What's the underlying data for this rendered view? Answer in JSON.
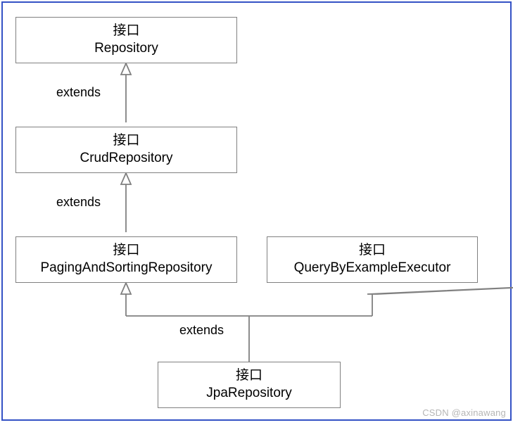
{
  "diagram": {
    "stereotype_label": "接口",
    "nodes": {
      "repository": {
        "name": "Repository"
      },
      "crud": {
        "name": "CrudRepository"
      },
      "paging": {
        "name": "PagingAndSortingRepository"
      },
      "qbe": {
        "name": "QueryByExampleExecutor"
      },
      "jpa": {
        "name": "JpaRepository"
      }
    },
    "edges": {
      "crud_to_repo": {
        "label": "extends"
      },
      "paging_to_crud": {
        "label": "extends"
      },
      "jpa_to_parents": {
        "label": "extends"
      }
    }
  },
  "watermark": "CSDN @axinawang"
}
